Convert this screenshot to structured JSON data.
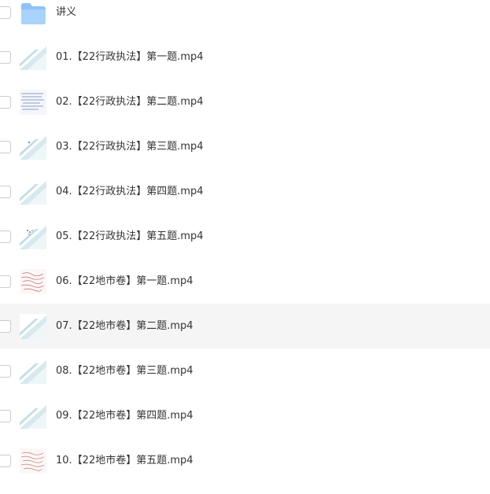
{
  "colors": {
    "hover_row": "#f5f5f6",
    "folder": "#8cc2f7",
    "text": "#333333"
  },
  "file_list": {
    "items": [
      {
        "name": "讲义",
        "type": "folder",
        "icon": "folder-icon"
      },
      {
        "name": "01.【22行政执法】第一题.mp4",
        "type": "video",
        "icon": "video-thumbnail-icon"
      },
      {
        "name": "02.【22行政执法】第二题.mp4",
        "type": "video",
        "icon": "video-thumbnail-icon"
      },
      {
        "name": "03.【22行政执法】第三题.mp4",
        "type": "video",
        "icon": "video-thumbnail-icon"
      },
      {
        "name": "04.【22行政执法】第四题.mp4",
        "type": "video",
        "icon": "video-thumbnail-icon"
      },
      {
        "name": "05.【22行政执法】第五题.mp4",
        "type": "video",
        "icon": "video-thumbnail-icon"
      },
      {
        "name": "06.【22地市卷】第一题.mp4",
        "type": "video",
        "icon": "video-thumbnail-icon"
      },
      {
        "name": "07.【22地市卷】第二题.mp4",
        "type": "video",
        "icon": "video-thumbnail-icon",
        "hovered": true
      },
      {
        "name": "08.【22地市卷】第三题.mp4",
        "type": "video",
        "icon": "video-thumbnail-icon"
      },
      {
        "name": "09.【22地市卷】第四题.mp4",
        "type": "video",
        "icon": "video-thumbnail-icon"
      },
      {
        "name": "10.【22地市卷】第五题.mp4",
        "type": "video",
        "icon": "video-thumbnail-icon"
      }
    ]
  }
}
